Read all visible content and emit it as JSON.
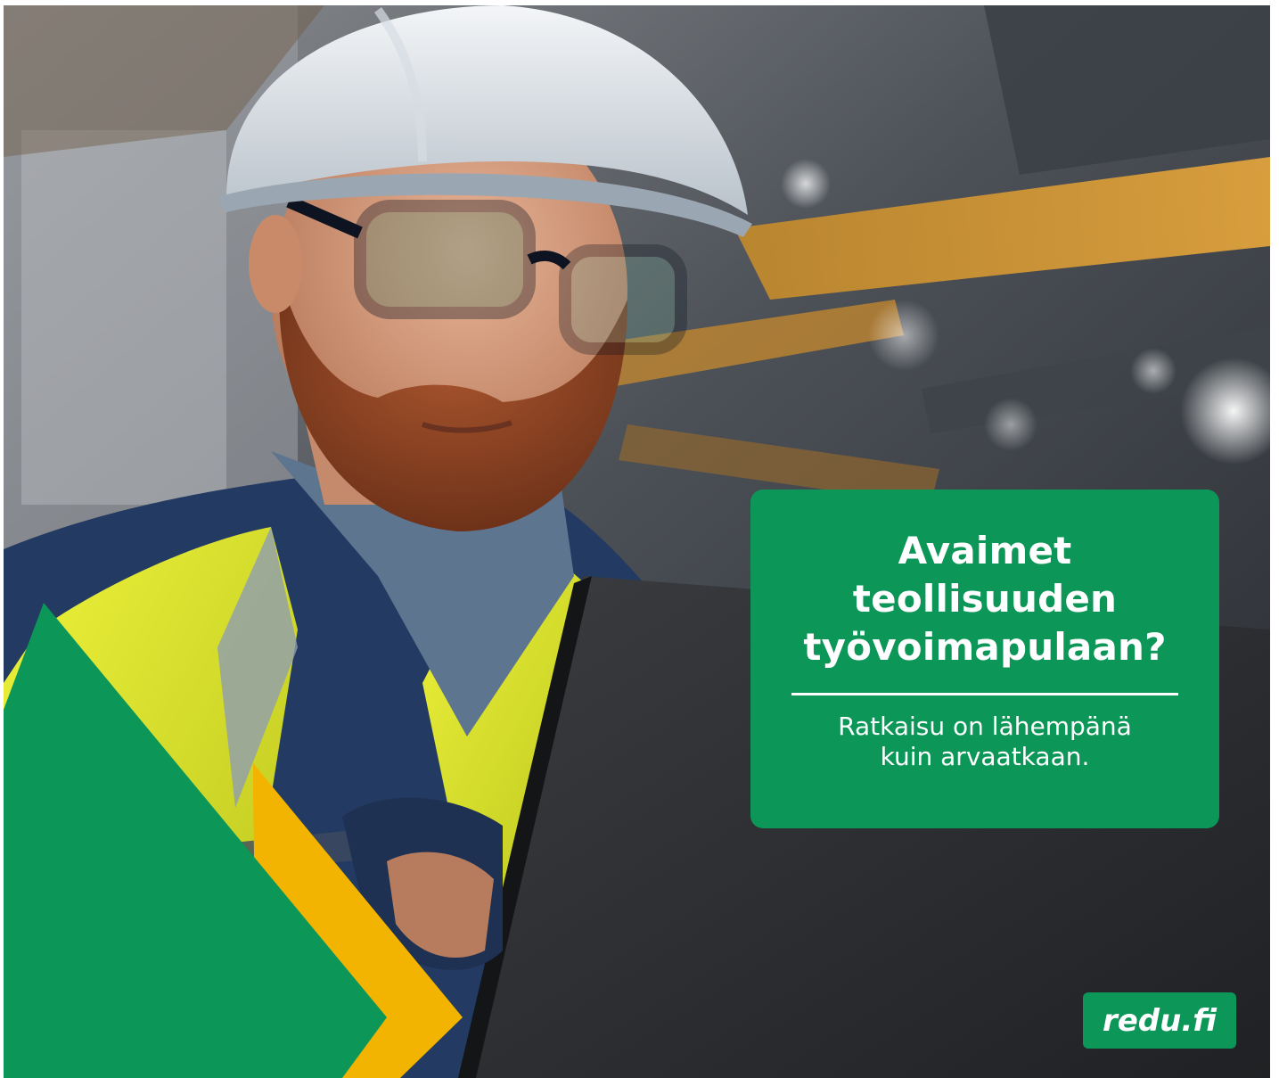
{
  "headline": {
    "line1": "Avaimet",
    "line2": "teollisuuden",
    "line3": "työvoimapulaan?"
  },
  "subline": {
    "line1": "Ratkaisu on lähempänä",
    "line2": "kuin arvaatkaan."
  },
  "brand": {
    "url": "redu.fi"
  },
  "colors": {
    "brand_green": "#0c9658",
    "accent_yellow": "#f2b400",
    "text": "#ffffff"
  }
}
